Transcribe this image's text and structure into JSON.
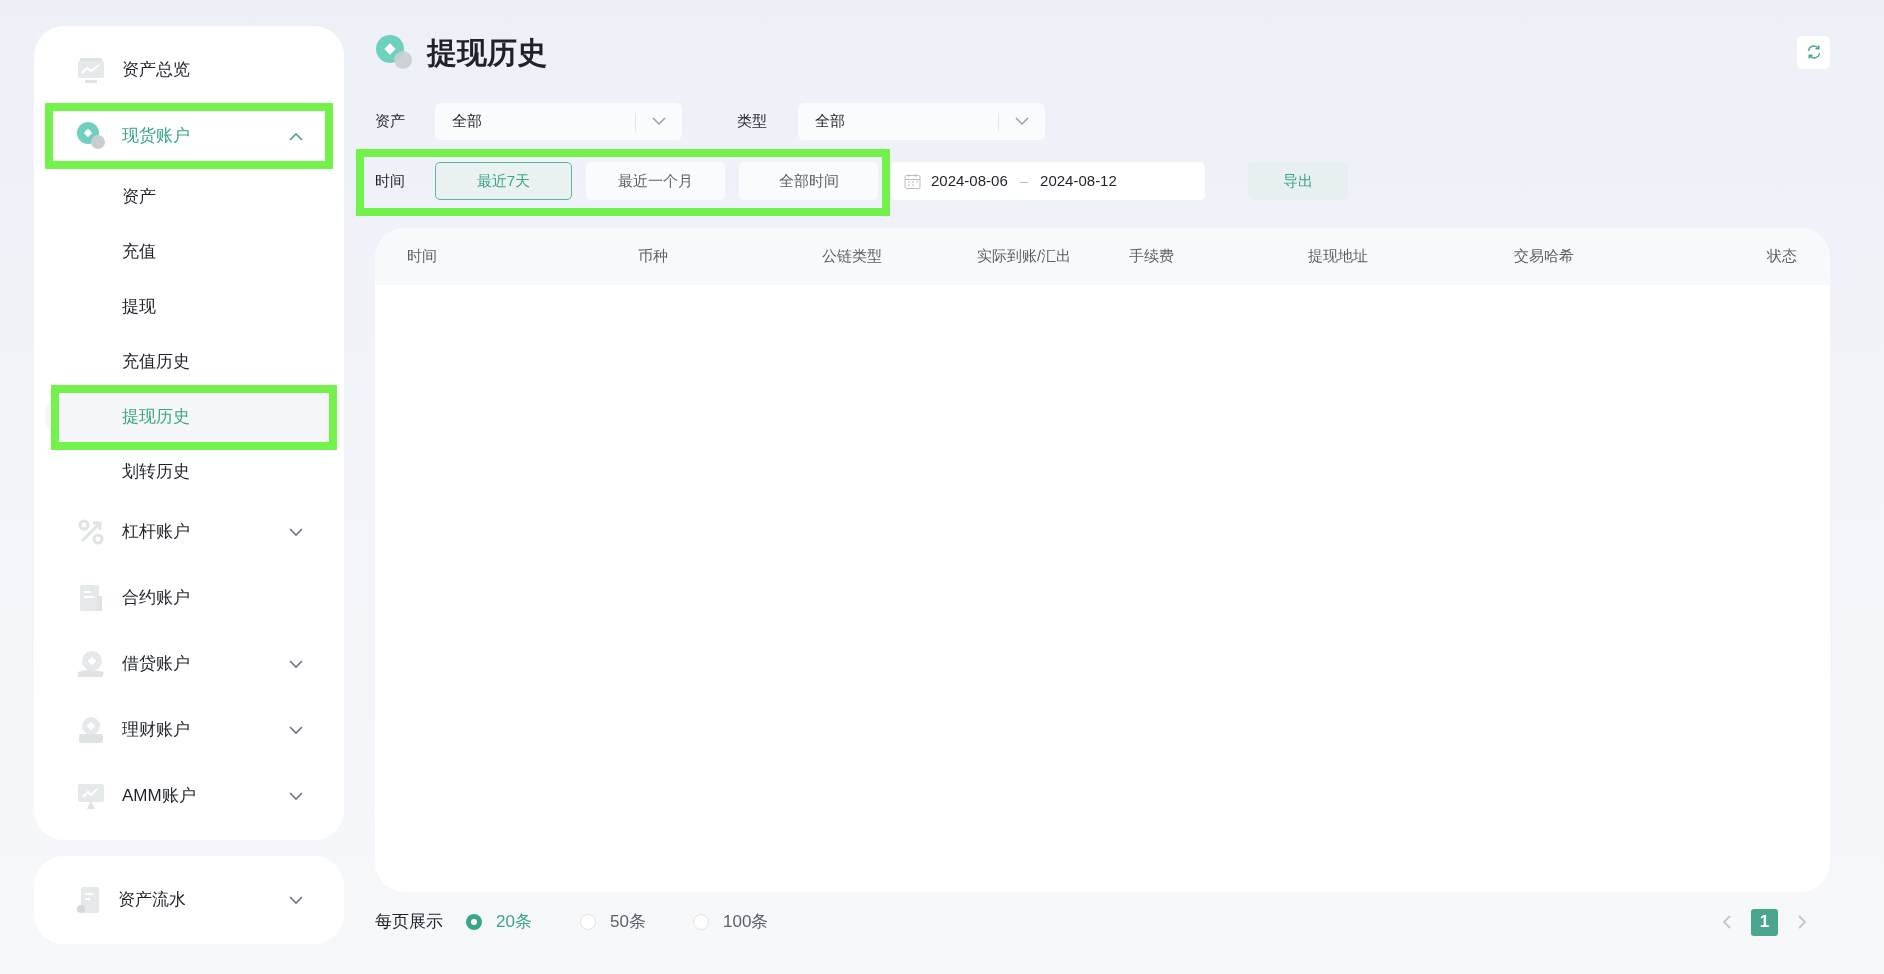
{
  "sidebar": {
    "items": [
      {
        "kind": "link",
        "label": "资产总览",
        "selected": false
      },
      {
        "kind": "group",
        "label": "现货账户",
        "selected": true,
        "expanded": true,
        "highlighted": true,
        "children": [
          {
            "label": "资产",
            "selected": false,
            "highlighted": false
          },
          {
            "label": "充值",
            "selected": false,
            "highlighted": false
          },
          {
            "label": "提现",
            "selected": false,
            "highlighted": false
          },
          {
            "label": "充值历史",
            "selected": false,
            "highlighted": false
          },
          {
            "label": "提现历史",
            "selected": true,
            "highlighted": true
          },
          {
            "label": "划转历史",
            "selected": false,
            "highlighted": false
          }
        ]
      },
      {
        "kind": "group",
        "label": "杠杆账户",
        "selected": false,
        "expanded": false,
        "highlighted": false
      },
      {
        "kind": "link",
        "label": "合约账户",
        "selected": false
      },
      {
        "kind": "group",
        "label": "借贷账户",
        "selected": false,
        "expanded": false,
        "highlighted": false
      },
      {
        "kind": "group",
        "label": "理财账户",
        "selected": false,
        "expanded": false,
        "highlighted": false
      },
      {
        "kind": "group",
        "label": "AMM账户",
        "selected": false,
        "expanded": false,
        "highlighted": false
      }
    ],
    "bottom_items": [
      {
        "kind": "group",
        "label": "资产流水",
        "selected": false,
        "expanded": false,
        "highlighted": false
      }
    ]
  },
  "header": {
    "title": "提现历史"
  },
  "filters": {
    "asset": {
      "label": "资产",
      "value": "全部"
    },
    "type": {
      "label": "类型",
      "value": "全部"
    },
    "time": {
      "label": "时间",
      "highlighted": true,
      "options": [
        {
          "label": "最近7天",
          "selected": true
        },
        {
          "label": "最近一个月",
          "selected": false
        },
        {
          "label": "全部时间",
          "selected": false
        }
      ]
    },
    "date_range": {
      "start": "2024-08-06",
      "separator": "–",
      "end": "2024-08-12"
    },
    "export_button": "导出"
  },
  "table": {
    "columns": [
      "时间",
      "币种",
      "公链类型",
      "实际到账/汇出",
      "手续费",
      "提现地址",
      "交易哈希",
      "状态"
    ]
  },
  "footer": {
    "page_size_label": "每页展示",
    "page_sizes": [
      {
        "label": "20条",
        "selected": true
      },
      {
        "label": "50条",
        "selected": false
      },
      {
        "label": "100条",
        "selected": false
      }
    ],
    "pages": [
      {
        "label": "1",
        "selected": true
      }
    ]
  }
}
